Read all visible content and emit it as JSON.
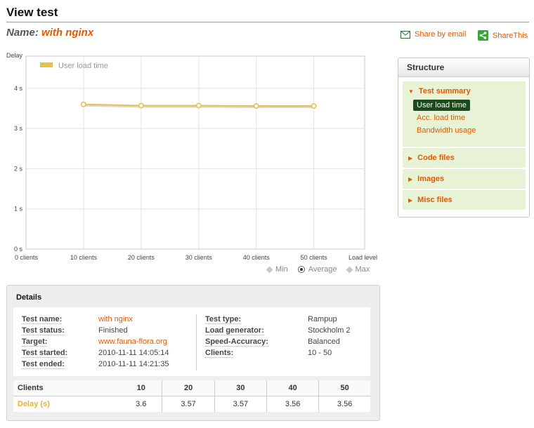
{
  "page": {
    "title": "View test",
    "name_label": "Name:",
    "name_value": "with nginx",
    "share_email": "Share by email",
    "share_this": "ShareThis"
  },
  "chart_data": {
    "type": "line",
    "ylabel": "Delay",
    "xlabel": "Load level",
    "categories": [
      "0 clients",
      "10 clients",
      "20 clients",
      "30 clients",
      "40 clients",
      "50 clients"
    ],
    "y_ticks": [
      "0 s",
      "1 s",
      "2 s",
      "3 s",
      "4 s"
    ],
    "ylim": [
      0,
      4.8
    ],
    "grid": true,
    "legend_position": "top-left",
    "series": [
      {
        "name": "User load time",
        "color": "#e8c04a",
        "x": [
          10,
          20,
          30,
          40,
          50
        ],
        "values": [
          3.6,
          3.57,
          3.57,
          3.56,
          3.56
        ]
      }
    ]
  },
  "toggles": {
    "min": "Min",
    "average": "Average",
    "max": "Max",
    "selected": "Average"
  },
  "details": {
    "title": "Details",
    "left": [
      {
        "key": "Test name:",
        "value": "with nginx",
        "link": true
      },
      {
        "key": "Test status:",
        "value": "Finished",
        "link": false
      },
      {
        "key": "Target:",
        "value": "www.fauna-flora.org",
        "link": true
      },
      {
        "key": "Test started:",
        "value": "2010-11-11 14:05:14",
        "link": false
      },
      {
        "key": "Test ended:",
        "value": "2010-11-11 14:21:35",
        "link": false
      }
    ],
    "right": [
      {
        "key": "Test type:",
        "value": "Rampup"
      },
      {
        "key": "Load generator:",
        "value": "Stockholm 2"
      },
      {
        "key": "Speed-Accuracy:",
        "value": "Balanced"
      },
      {
        "key": "Clients:",
        "value": "10 - 50"
      }
    ],
    "table": {
      "header_label": "Clients",
      "columns": [
        "10",
        "20",
        "30",
        "40",
        "50"
      ],
      "row_label": "Delay (s)",
      "row_values": [
        "3.6",
        "3.57",
        "3.57",
        "3.56",
        "3.56"
      ]
    }
  },
  "sidebar": {
    "title": "Structure",
    "sections": [
      {
        "label": "Test summary",
        "expanded": true,
        "items": [
          "User load time",
          "Acc. load time",
          "Bandwidth usage"
        ],
        "active": "User load time"
      },
      {
        "label": "Code files",
        "expanded": false
      },
      {
        "label": "Images",
        "expanded": false
      },
      {
        "label": "Misc files",
        "expanded": false
      }
    ]
  },
  "colors": {
    "accent": "#e05a00",
    "rule": "#8db33a",
    "series": "#e8c04a",
    "active_bg": "#1b4a1b",
    "sidebar_bg": "#e8f2d4"
  }
}
